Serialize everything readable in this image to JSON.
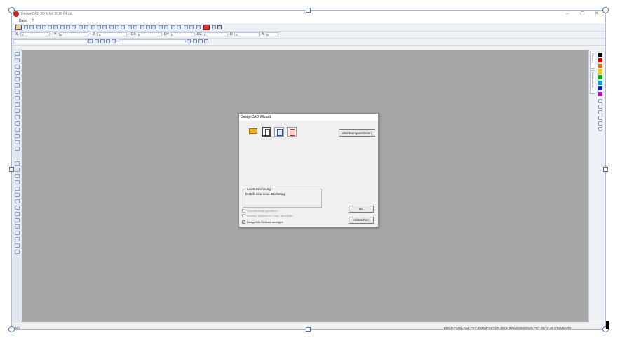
{
  "window": {
    "title": "DesignCAD 3D MAX 2016 64 bit",
    "controls": {
      "minimize": "–",
      "maximize": "▢",
      "close": "✕"
    }
  },
  "menu": {
    "items": [
      "Datei",
      "?"
    ]
  },
  "coords": [
    {
      "label": "X",
      "value": "0"
    },
    {
      "label": "Y",
      "value": "0"
    },
    {
      "label": "Z",
      "value": "0"
    },
    {
      "label": "DX",
      "value": "0"
    },
    {
      "label": "DY",
      "value": "0"
    },
    {
      "label": "DZ",
      "value": "0"
    },
    {
      "label": "D",
      "value": "0"
    },
    {
      "label": "A",
      "value": "0"
    }
  ],
  "side_tabs": [
    "Themes",
    "Struktur/Info"
  ],
  "palette": [
    "#000000",
    "#e00000",
    "#e07000",
    "#f0d000",
    "#00b000",
    "#00a0e0",
    "#0020c0",
    "#c000c0"
  ],
  "wizard": {
    "title": "DesignCAD Wizard",
    "units_button": "Zeichnungseinheiten",
    "group_label": "Leere Zeichnung",
    "group_text": "Erstellt eine neue Zeichnung",
    "checkboxes": [
      {
        "label": "Zeilenanzeige ignorieren",
        "checked": false,
        "enabled": false
      },
      {
        "label": "Anzeige schnellerer Frage ignorieren",
        "checked": false,
        "enabled": false
      },
      {
        "label": "DesignCAD Wizard anzeigen",
        "checked": true,
        "enabled": true
      }
    ],
    "ok": "OK",
    "cancel": "Abbrechen",
    "check_mark": "✔"
  },
  "status": {
    "left": "Hilfe",
    "right": "ERGH FANG ANZ PKT ZOOMFAKTOR ZEICHNUNGSMODUS PKT SETZ 48 STANDARD"
  }
}
